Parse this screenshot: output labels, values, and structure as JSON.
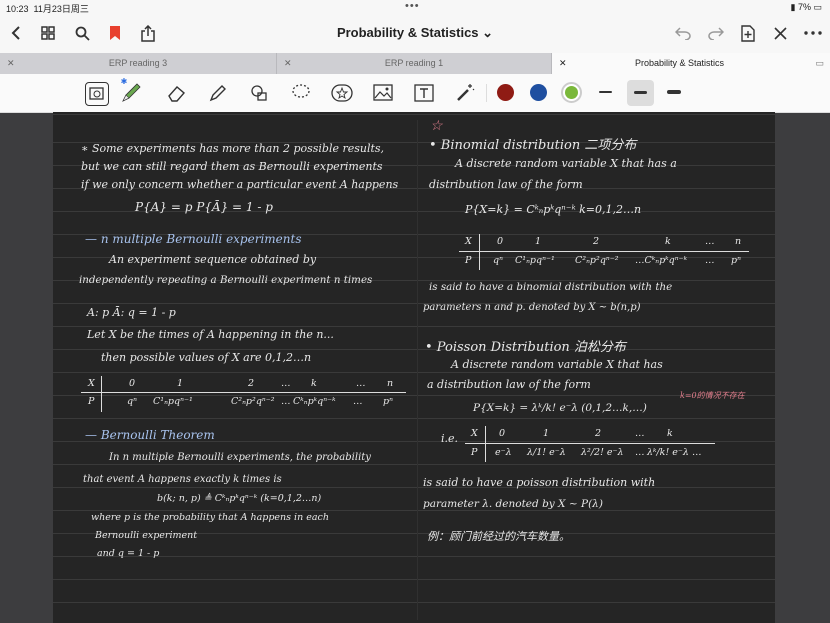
{
  "status": {
    "time": "10:23",
    "date": "11月23日周三",
    "battery": "7%"
  },
  "nav": {
    "title": "Probability & Statistics ⌄"
  },
  "tabs": [
    {
      "label": "ERP reading 3"
    },
    {
      "label": "ERP reading 1"
    },
    {
      "label": "Probability & Statistics"
    }
  ],
  "colors": {
    "dark_red": "#8f1b14",
    "blue": "#1f4fa0",
    "green": "#7ab83a"
  },
  "left": {
    "l1": "∗ Some experiments has more than 2 possible results,",
    "l2": "but we can still regard them as Bernoulli experiments",
    "l3": "if we only concern whether a particular event A happens",
    "l4": "P{A} = p     P{Ā} = 1 - p",
    "h1": "— n multiple Bernoulli experiments",
    "l5": "An experiment sequence obtained by",
    "l6": "independently repeating a Bernoulli experiment n times",
    "l7": "A: p    Ā: q = 1 - p",
    "l8": "Let X be the times of A happening in the n...",
    "l9": "then possible values of X are  0,1,2…n",
    "t1": {
      "row1": [
        "X",
        "0",
        "1",
        "2",
        "…",
        "k",
        "…",
        "n"
      ],
      "row2": [
        "P",
        "qⁿ",
        "C¹ₙpqⁿ⁻¹",
        "C²ₙp²qⁿ⁻²",
        "…",
        "Cᵏₙpᵏqⁿ⁻ᵏ",
        "…",
        "pⁿ"
      ]
    },
    "h2": "— Bernoulli Theorem",
    "l10": "In n multiple Bernoulli experiments, the probability",
    "l11": "that event A happens exactly k times is",
    "l12": "b(k; n, p) ≜ Cᵏₙpᵏqⁿ⁻ᵏ  (k=0,1,2…n)",
    "l13": "where p is the probability that A happens in each",
    "l14": "Bernoulli experiment",
    "l15": "and  q = 1 - p"
  },
  "right": {
    "h1": "• Binomial distribution 二项分布",
    "l1": "A discrete random variable X that has a",
    "l2": "distribution law of the form",
    "l3": "P{X=k} = Cᵏₙpᵏqⁿ⁻ᵏ     k=0,1,2…n",
    "t1": {
      "row1": [
        "X",
        "0",
        "1",
        "2",
        "k",
        "…",
        "n"
      ],
      "row2": [
        "P",
        "qⁿ",
        "C¹ₙpqⁿ⁻¹",
        "C²ₙp²qⁿ⁻²",
        "…Cᵏₙpᵏqⁿ⁻ᵏ",
        "…",
        "pⁿ"
      ]
    },
    "l4": "is said to have a binomial distribution with the",
    "l5": "parameters n and p. denoted by  X ~ b(n,p)",
    "h2": "• Poisson Distribution 泊松分布",
    "l6": "A discrete random variable X that has",
    "l7": "a distribution law of the form",
    "l8": "P{X=k} = λᵏ/k! e⁻λ   (0,1,2…k,…)",
    "note": "k=0的情况不存在",
    "ie": "i.e.",
    "t2": {
      "row1": [
        "X",
        "0",
        "1",
        "2",
        "…",
        "k"
      ],
      "row2": [
        "P",
        "e⁻λ",
        "λ/1! e⁻λ",
        "λ²/2! e⁻λ",
        "…",
        "λᵏ/k! e⁻λ …"
      ]
    },
    "l9": "is said to have a poisson distribution with",
    "l10": "parameter λ. denoted by  X ~ P(λ)",
    "l11": "例：顾门前经过的汽车数量。"
  }
}
